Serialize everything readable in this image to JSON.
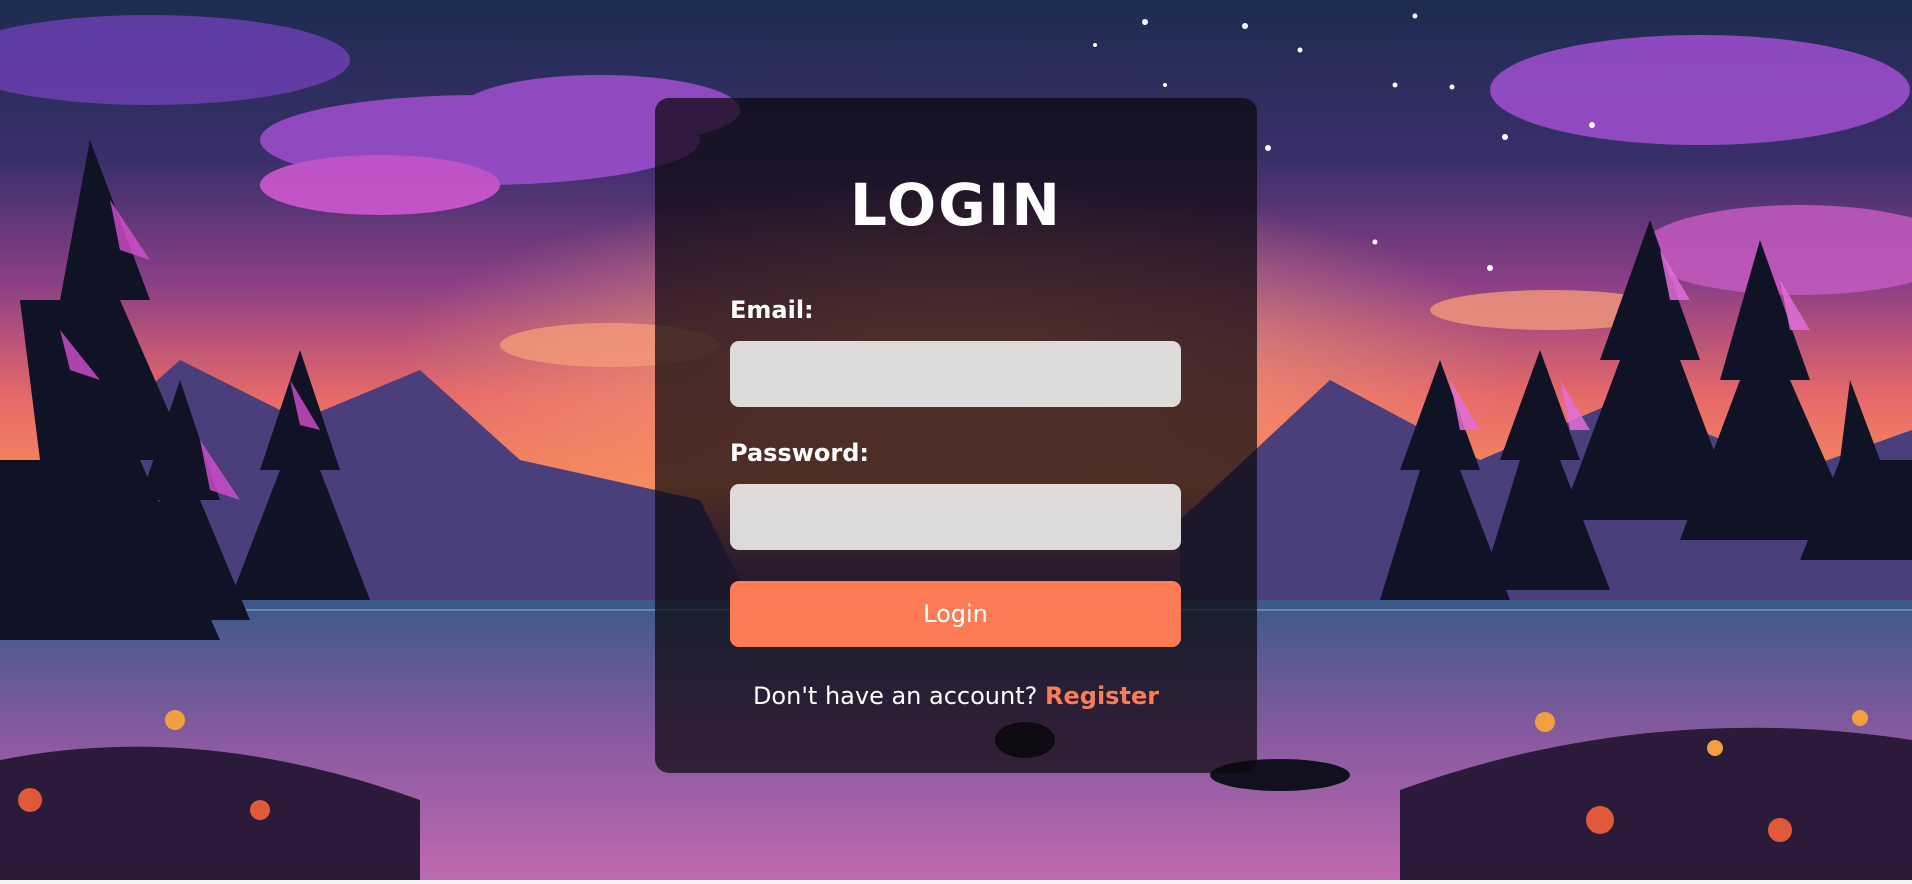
{
  "background": {
    "description_icon": "night-lake-landscape",
    "sky_top_color": "#1b2a4e",
    "sky_glow_color": "#f07a54",
    "accent_purple": "#8a3fd0"
  },
  "login": {
    "title": "LOGIN",
    "email_label": "Email:",
    "email_value": "",
    "password_label": "Password:",
    "password_value": "",
    "button_label": "Login",
    "register_prompt": "Don't have an account?",
    "register_link": "Register"
  },
  "colors": {
    "accent": "#fd7c56",
    "card_bg": "rgba(12,8,14,0.72)",
    "input_bg": "#eeeeee"
  }
}
